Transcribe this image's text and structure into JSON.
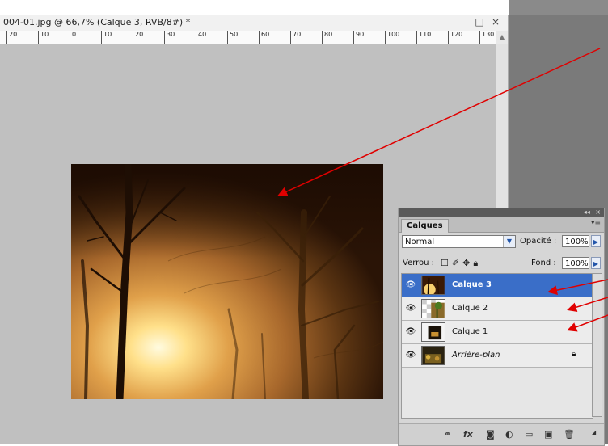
{
  "window": {
    "title": "004-01.jpg @ 66,7% (Calque 3, RVB/8#) *",
    "minimize": "_",
    "maximize": "□",
    "close": "×"
  },
  "ruler": {
    "labels": [
      "20",
      "10",
      "0",
      "10",
      "20",
      "30",
      "40",
      "50",
      "60",
      "70",
      "80",
      "90",
      "100",
      "110",
      "120",
      "130"
    ]
  },
  "layers_panel": {
    "collapse_icon": "◂◂",
    "close_icon": "×",
    "tab_label": "Calques",
    "blend_mode": "Normal",
    "opacity_label": "Opacité :",
    "opacity_value": "100%",
    "lock_label": "Verrou :",
    "fill_label": "Fond :",
    "fill_value": "100%",
    "layers": [
      {
        "name": "Calque 3",
        "selected": true
      },
      {
        "name": "Calque 2",
        "selected": false
      },
      {
        "name": "Calque 1",
        "selected": false
      },
      {
        "name": "Arrière-plan",
        "selected": false,
        "locked": true
      }
    ],
    "bottom_icons": [
      "link-icon",
      "fx-icon",
      "mask-icon",
      "adjustment-icon",
      "folder-icon",
      "new-layer-icon",
      "trash-icon"
    ]
  },
  "colors": {
    "selection": "#3a6ec8",
    "annotation_arrow": "#e00000",
    "workspace": "#7a7a7a",
    "canvas": "#c0c0c0"
  }
}
